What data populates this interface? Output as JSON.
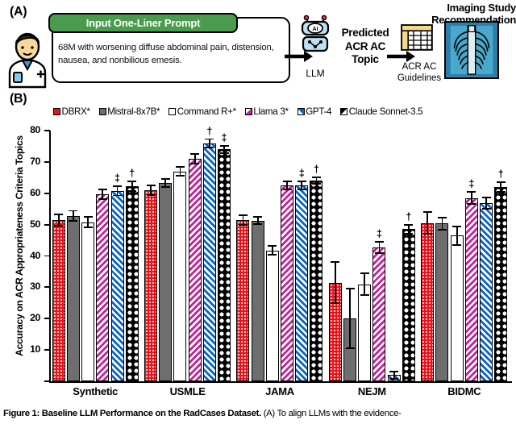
{
  "panel_a": {
    "label": "(A)",
    "prompt_header": "Input One-Liner Prompt",
    "prompt_text": "68M with worsening diffuse abdominal pain, distension, nausea, and nonbilious emesis.",
    "llm_label": "LLM",
    "predicted_label": "Predicted ACR AC Topic",
    "guidelines_label": "ACR AC Guidelines",
    "imaging_title": "Imaging Study Recommendation",
    "robot_badge": "AI",
    "icons": {
      "doctor": "doctor-avatar-icon",
      "robot": "ai-robot-icon",
      "table": "spreadsheet-icon",
      "xray": "chest-xray-icon",
      "arrow": "right-arrow-icon"
    }
  },
  "panel_b": {
    "label": "(B)",
    "legend": [
      {
        "label": "DBRX*",
        "fill": "red"
      },
      {
        "label": "Mistral-8x7B*",
        "fill": "gray"
      },
      {
        "label": "Command R+*",
        "fill": "white"
      },
      {
        "label": "Llama 3*",
        "fill": "mag"
      },
      {
        "label": "GPT-4",
        "fill": "blue"
      },
      {
        "label": "Claude Sonnet-3.5",
        "fill": "black"
      }
    ]
  },
  "chart_data": {
    "type": "bar",
    "title": "",
    "xlabel": "",
    "ylabel": "Accuracy on ACR Appropriateness Criteria Topics",
    "ylim": [
      0,
      80
    ],
    "yticks": [
      0,
      10,
      20,
      30,
      40,
      50,
      60,
      70,
      80
    ],
    "ytick_labels": [
      "",
      "10",
      "20",
      "30",
      "40",
      "50",
      "60",
      "70",
      "80"
    ],
    "grid": false,
    "legend_position": "top",
    "categories": [
      "Synthetic",
      "USMLE",
      "JAMA",
      "NEJM",
      "BIDMC"
    ],
    "series": [
      {
        "name": "DBRX*",
        "fill": "red",
        "values": [
          51.5,
          61.0,
          51.5,
          31.5,
          50.5
        ],
        "errors": [
          1.8,
          1.5,
          1.5,
          6.5,
          3.5
        ],
        "sig": [
          "",
          "",
          "",
          "",
          ""
        ]
      },
      {
        "name": "Mistral-8x7B*",
        "fill": "gray",
        "values": [
          52.8,
          63.3,
          51.3,
          20.0,
          50.3
        ],
        "errors": [
          1.6,
          1.2,
          1.2,
          9.5,
          2.0
        ],
        "sig": [
          "",
          "",
          "",
          "",
          ""
        ]
      },
      {
        "name": "Command R+*",
        "fill": "white",
        "values": [
          50.8,
          67.0,
          41.8,
          31.0,
          46.5
        ],
        "errors": [
          1.6,
          1.5,
          1.5,
          3.5,
          3.0
        ],
        "sig": [
          "",
          "",
          "",
          "",
          ""
        ]
      },
      {
        "name": "Llama 3*",
        "fill": "mag",
        "values": [
          59.7,
          71.0,
          62.5,
          42.8,
          58.5
        ],
        "errors": [
          1.5,
          1.5,
          1.2,
          1.8,
          2.0
        ],
        "sig": [
          "",
          "",
          "",
          "‡",
          "‡"
        ]
      },
      {
        "name": "GPT-4",
        "fill": "blue",
        "values": [
          60.8,
          76.0,
          62.5,
          2.0,
          56.8
        ],
        "errors": [
          1.5,
          1.3,
          1.2,
          1.2,
          1.8
        ],
        "sig": [
          "‡",
          "†",
          "‡",
          "",
          ""
        ]
      },
      {
        "name": "Claude Sonnet-3.5",
        "fill": "black",
        "values": [
          62.3,
          74.0,
          64.0,
          48.5,
          62.0
        ],
        "errors": [
          1.5,
          1.2,
          1.0,
          1.5,
          1.5
        ],
        "sig": [
          "†",
          "‡",
          "†",
          "†",
          "†"
        ]
      }
    ]
  },
  "caption": {
    "bold": "Figure 1: Baseline LLM Performance on the RadCases Dataset.",
    "rest": " (A) To align LLMs with the evidence-"
  }
}
